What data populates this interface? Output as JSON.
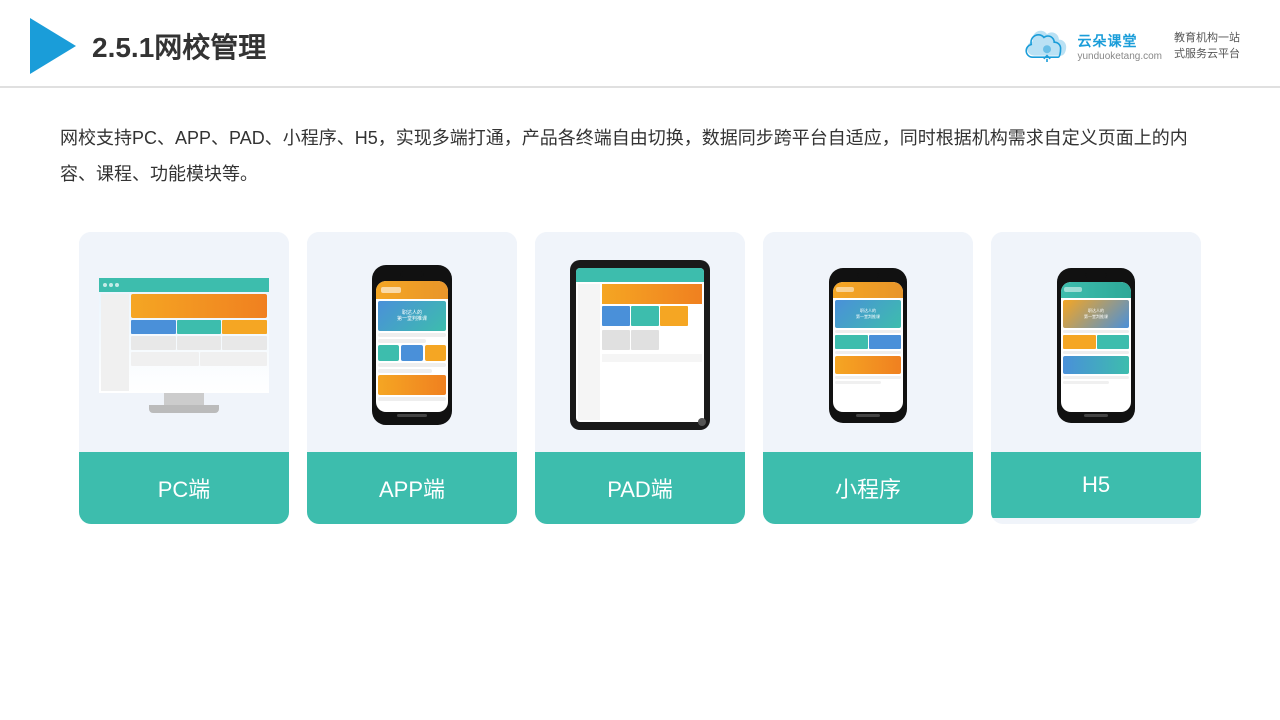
{
  "header": {
    "title": "2.5.1网校管理",
    "brand": {
      "name": "云朵课堂",
      "url": "yunduoketang.com",
      "slogan": "教育机构一站\n式服务云平台"
    }
  },
  "description": "网校支持PC、APP、PAD、小程序、H5，实现多端打通，产品各终端自由切换，数据同步跨平台自适应，同时根据机构需求自定义页面上的内容、课程、功能模块等。",
  "cards": [
    {
      "id": "pc",
      "label": "PC端"
    },
    {
      "id": "app",
      "label": "APP端"
    },
    {
      "id": "pad",
      "label": "PAD端"
    },
    {
      "id": "miniapp",
      "label": "小程序"
    },
    {
      "id": "h5",
      "label": "H5"
    }
  ],
  "colors": {
    "accent": "#3dbdad",
    "brand_blue": "#1a9dd9",
    "orange": "#f5a623",
    "dark": "#333"
  }
}
